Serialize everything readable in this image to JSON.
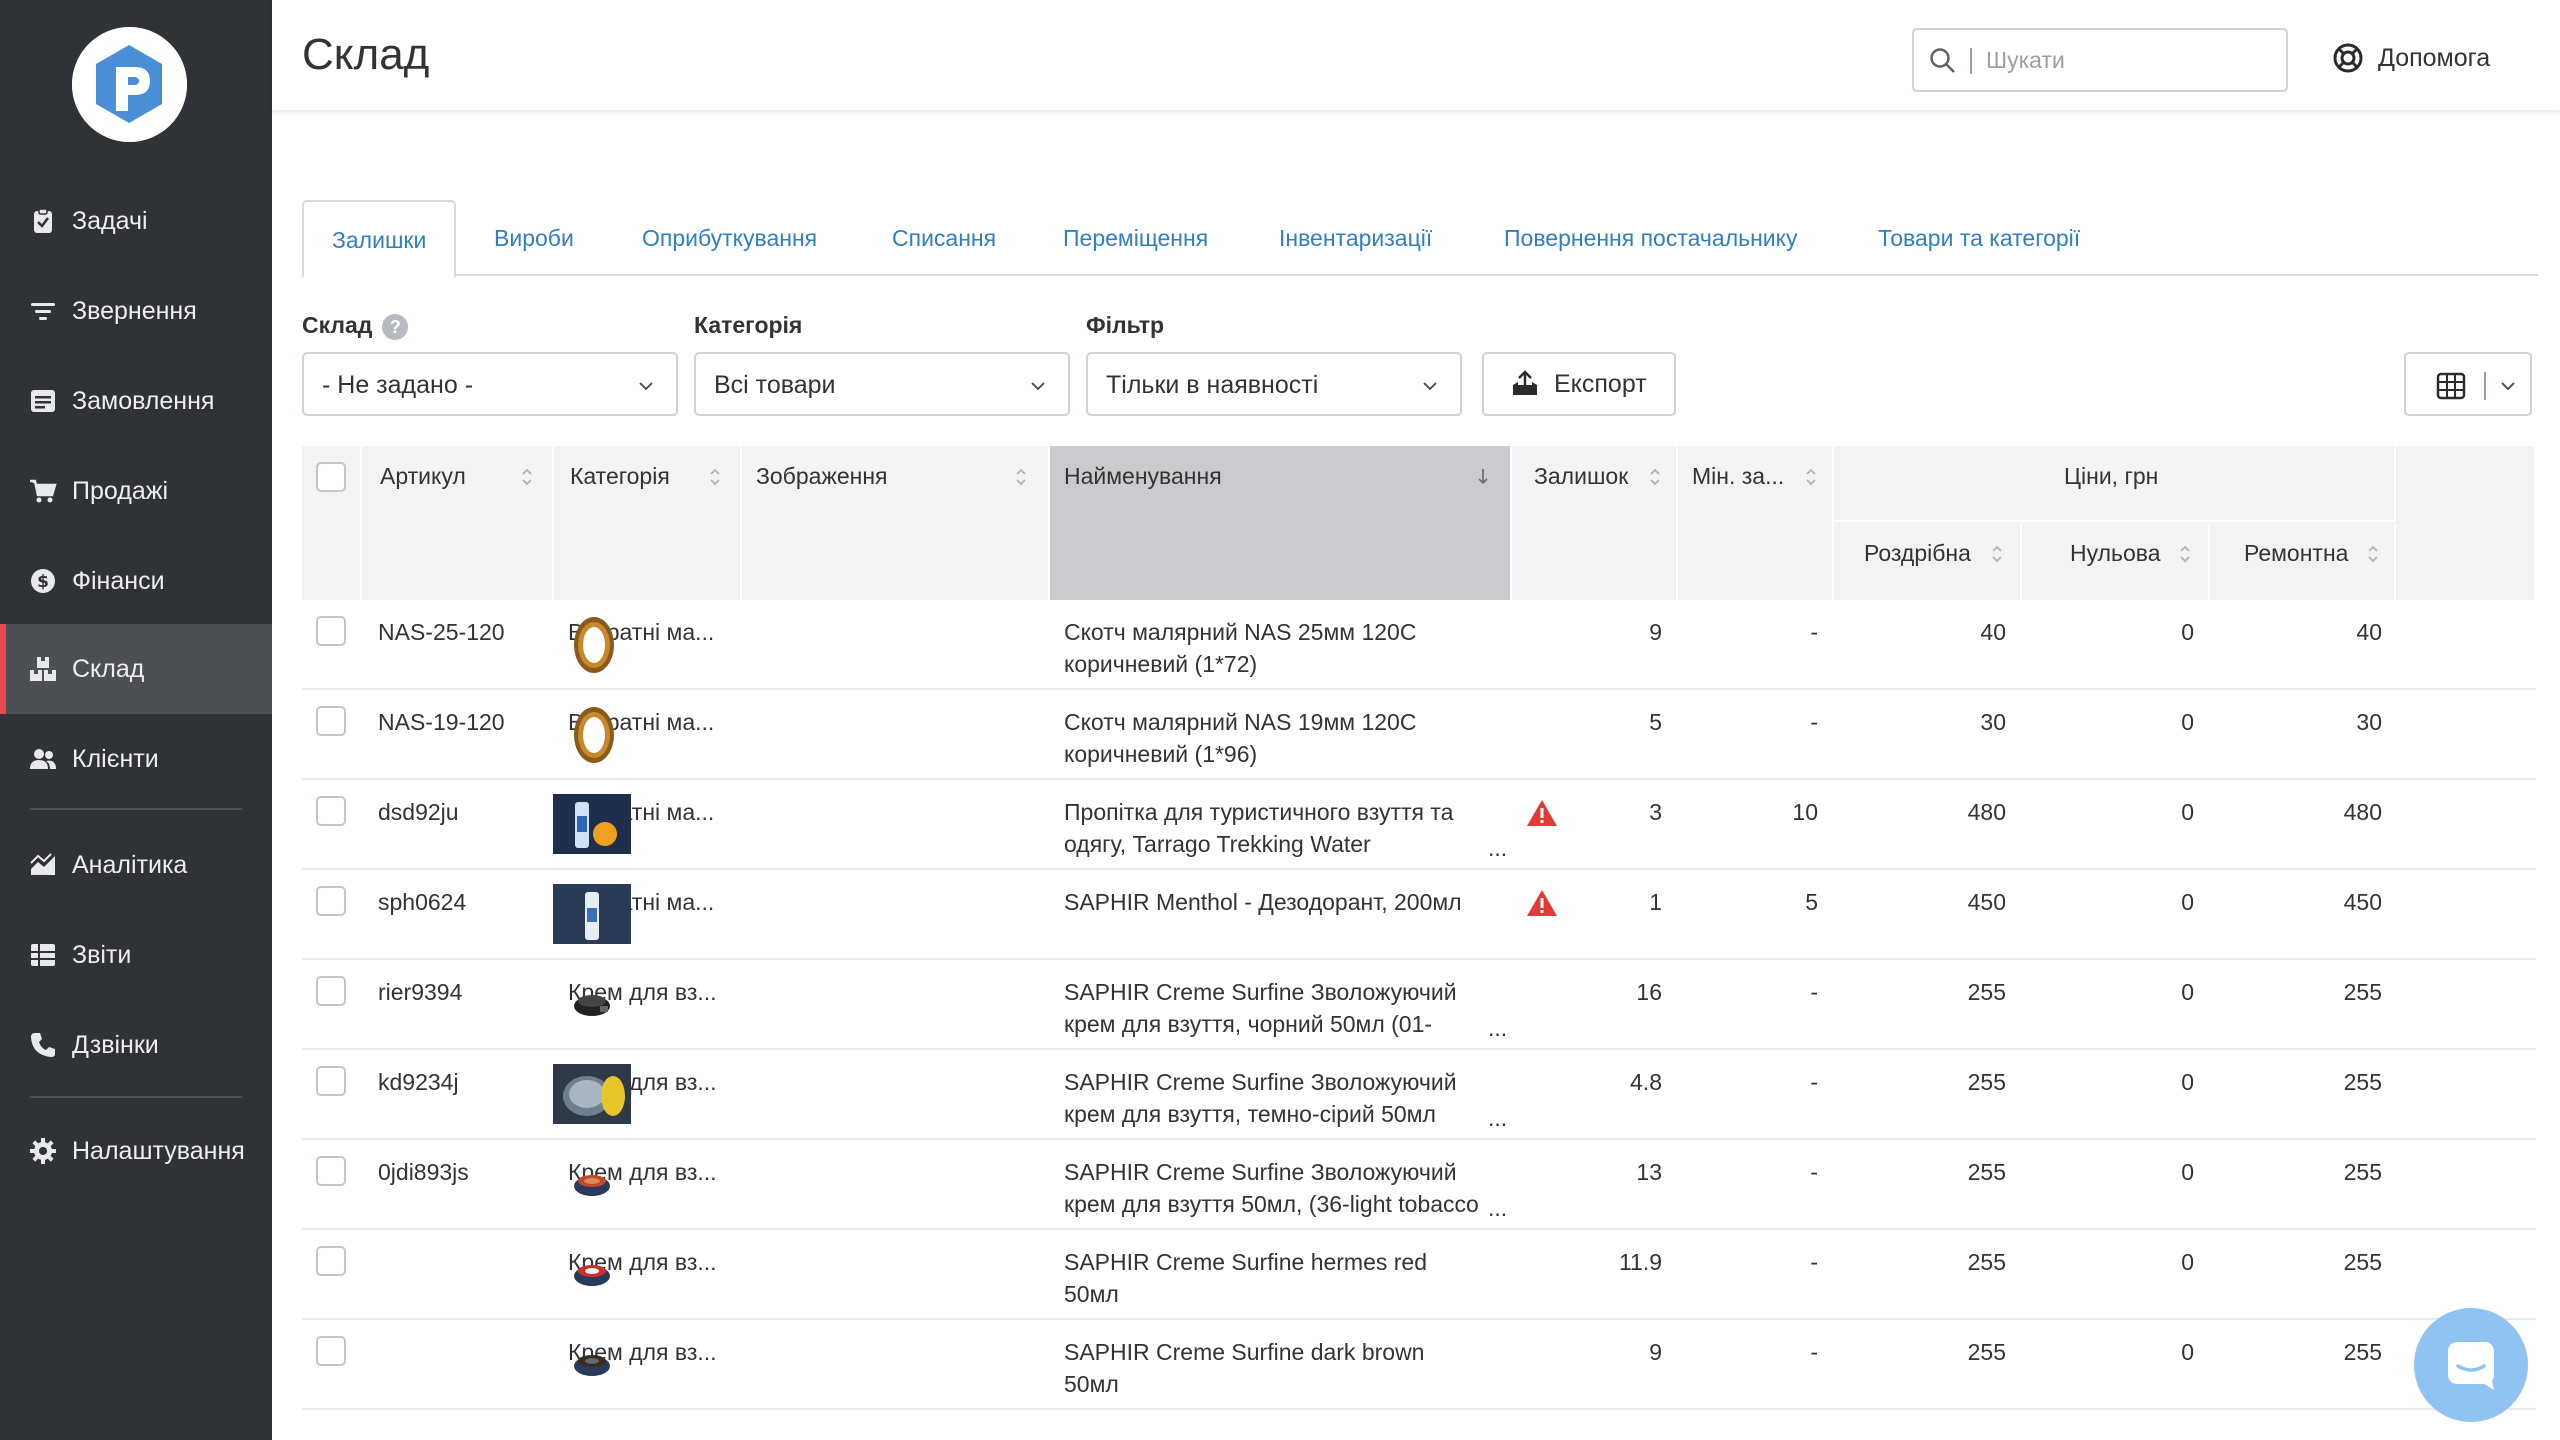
{
  "sidebar": {
    "items": [
      {
        "label": "Задачі",
        "icon": "clipboard-check-icon"
      },
      {
        "label": "Звернення",
        "icon": "filter-icon"
      },
      {
        "label": "Замовлення",
        "icon": "order-list-icon"
      },
      {
        "label": "Продажі",
        "icon": "cart-icon"
      },
      {
        "label": "Фінанси",
        "icon": "dollar-circle-icon"
      },
      {
        "label": "Склад",
        "icon": "boxes-icon",
        "active": true
      },
      {
        "label": "Клієнти",
        "icon": "users-icon"
      },
      {
        "label": "Аналітика",
        "icon": "area-chart-icon"
      },
      {
        "label": "Звіти",
        "icon": "report-table-icon"
      },
      {
        "label": "Дзвінки",
        "icon": "phone-icon"
      },
      {
        "label": "Налаштування",
        "icon": "gear-icon"
      }
    ]
  },
  "header": {
    "title": "Склад",
    "search_placeholder": "Шукати",
    "help_label": "Допомога"
  },
  "tabs": [
    "Залишки",
    "Вироби",
    "Оприбуткування",
    "Списання",
    "Переміщення",
    "Інвентаризації",
    "Повернення постачальнику",
    "Товари та категорії"
  ],
  "filters": {
    "warehouse": {
      "label": "Склад",
      "value": "- Не задано -"
    },
    "category": {
      "label": "Категорія",
      "value": "Всі товари"
    },
    "filter": {
      "label": "Фільтр",
      "value": "Тільки в наявності"
    },
    "export_label": "Експорт"
  },
  "table": {
    "columns": {
      "sku": "Артикул",
      "category": "Категорія",
      "image": "Зображення",
      "name": "Найменування",
      "stock": "Залишок",
      "min": "Мін. за...",
      "prices_group": "Ціни, грн",
      "retail": "Роздрібна",
      "zero": "Нульова",
      "repair": "Ремонтна"
    },
    "rows": [
      {
        "sku": "NAS-25-120",
        "category": "Витратні ма...",
        "thumb": "tape",
        "name1": "Скотч малярний NAS 25мм 120С",
        "name2": "коричневий (1*72)",
        "more": "",
        "warn": false,
        "stock": "9",
        "min": "-",
        "retail": "40",
        "zero": "0",
        "repair": "40"
      },
      {
        "sku": "NAS-19-120",
        "category": "Витратні ма...",
        "thumb": "tape",
        "name1": "Скотч малярний NAS 19мм 120С",
        "name2": "коричневий (1*96)",
        "more": "",
        "warn": false,
        "stock": "5",
        "min": "-",
        "retail": "30",
        "zero": "0",
        "repair": "30"
      },
      {
        "sku": "dsd92ju",
        "category": "Витратні ма...",
        "thumb": "spray",
        "name1": "Пропітка для туристичного взуття та",
        "name2": "одягу, Tarrago Trekking Water",
        "more": "...",
        "warn": true,
        "stock": "3",
        "min": "10",
        "retail": "480",
        "zero": "0",
        "repair": "480"
      },
      {
        "sku": "sph0624",
        "category": "Витратні ма...",
        "thumb": "spray2",
        "name1": "SAPHIR Menthol - Дезодорант, 200мл",
        "name2": "",
        "more": "",
        "warn": true,
        "stock": "1",
        "min": "5",
        "retail": "450",
        "zero": "0",
        "repair": "450"
      },
      {
        "sku": "rier9394",
        "category": "Крем для вз...",
        "thumb": "tin-black",
        "name1": "SAPHIR Creme Surfine Зволожуючий",
        "name2": "крем для взуття, чорний 50мл (01-",
        "more": "...",
        "warn": false,
        "stock": "16",
        "min": "-",
        "retail": "255",
        "zero": "0",
        "repair": "255"
      },
      {
        "sku": "kd9234j",
        "category": "Крем для вз...",
        "thumb": "tin-clear",
        "name1": "SAPHIR Creme Surfine Зволожуючий",
        "name2": "крем для взуття, темно-сірий 50мл",
        "more": "...",
        "warn": false,
        "stock": "4.8",
        "min": "-",
        "retail": "255",
        "zero": "0",
        "repair": "255"
      },
      {
        "sku": "0jdi893js",
        "category": "Крем для вз...",
        "thumb": "tin-tan",
        "name1": "SAPHIR Creme Surfine Зволожуючий",
        "name2": "крем для взуття 50мл, (36-light tobacco",
        "more": "...",
        "warn": false,
        "stock": "13",
        "min": "-",
        "retail": "255",
        "zero": "0",
        "repair": "255"
      },
      {
        "sku": "",
        "category": "Крем для вз...",
        "thumb": "tin-red",
        "name1": "SAPHIR Creme Surfine hermes red",
        "name2": "50мл",
        "more": "",
        "warn": false,
        "stock": "11.9",
        "min": "-",
        "retail": "255",
        "zero": "0",
        "repair": "255"
      },
      {
        "sku": "",
        "category": "Крем для вз...",
        "thumb": "tin-brown",
        "name1": "SAPHIR Creme Surfine dark brown",
        "name2": "50мл",
        "more": "",
        "warn": false,
        "stock": "9",
        "min": "-",
        "retail": "255",
        "zero": "0",
        "repair": "255"
      }
    ]
  },
  "colors": {
    "sidebar_bg": "#2f3236",
    "sidebar_active": "#4c5055",
    "accent_red": "#e5484d",
    "link_blue": "#2f7fc1",
    "warning_red": "#e53935",
    "chat_button": "#8ec3f2"
  }
}
